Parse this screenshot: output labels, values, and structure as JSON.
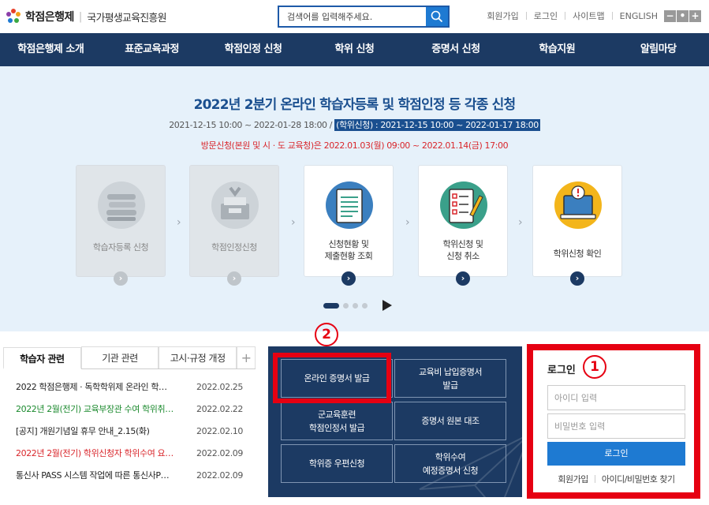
{
  "header": {
    "logo_title": "학점은행제",
    "logo_sub": "국가평생교육진흥원",
    "search_placeholder": "검색어를 입력해주세요.",
    "util_links": [
      "회원가입",
      "로그인",
      "사이트맵",
      "ENGLISH"
    ],
    "font_controls": [
      "−",
      "•",
      "+"
    ]
  },
  "nav": {
    "items": [
      "학점은행제 소개",
      "표준교육과정",
      "학점인정 신청",
      "학위 신청",
      "증명서 신청",
      "학습지원",
      "알림마당"
    ]
  },
  "hero": {
    "title": "2022년 2분기 온라인 학습자등록 및 학점인정 등 각종 신청",
    "date_range": "2021-12-15 10:00 ~ 2022-01-28 18:00 /",
    "date_highlight": "(학위신청) : 2021-12-15 10:00 ~ 2022-01-17 18:00",
    "visit_notice": "방문신청(본원 및 시 · 도 교육청)은 2022.01.03(월) 09:00 ~ 2022.01.14(금) 17:00",
    "cards": [
      {
        "label": "학습자등록 신청",
        "icon": "books-icon",
        "state": "disabled"
      },
      {
        "label": "학점인정신청",
        "icon": "inbox-tray-icon",
        "state": "disabled"
      },
      {
        "label": "신청현황 및\n제출현황 조회",
        "icon": "document-list-icon",
        "state": "active"
      },
      {
        "label": "학위신청 및\n신청 취소",
        "icon": "checklist-pencil-icon",
        "state": "active"
      },
      {
        "label": "학위신청 확인",
        "icon": "laptop-alert-icon",
        "state": "active"
      }
    ],
    "slider_total": 4,
    "slider_current": 1
  },
  "news": {
    "tabs": [
      "학습자 관련",
      "기관 관련",
      "고시·규정 개정"
    ],
    "plus": "+",
    "items": [
      {
        "title": "2022 학점은행제 · 독학학위제 온라인 학…",
        "date": "2022.02.25",
        "color": "dark"
      },
      {
        "title": "2022년 2월(전기) 교육부장관 수여 학위취…",
        "date": "2022.02.22",
        "color": "green"
      },
      {
        "title": "[공지] 개원기념일 휴무 안내_2.15(화)",
        "date": "2022.02.10",
        "color": "dark"
      },
      {
        "title": "2022년 2월(전기) 학위신청자 학위수여 요…",
        "date": "2022.02.09",
        "color": "red"
      },
      {
        "title": "통신사 PASS 시스템 작업에 따른 통신사P…",
        "date": "2022.02.09",
        "color": "dark"
      }
    ]
  },
  "quick": {
    "buttons": [
      "온라인 증명서 발급",
      "교육비 납입증명서\n발급",
      "군교육훈련\n학점인정서 발급",
      "증명서 원본 대조",
      "학위증 우편신청",
      "학위수여\n예정증명서 신청"
    ]
  },
  "login": {
    "title": "로그인",
    "id_placeholder": "아이디 입력",
    "pw_placeholder": "비밀번호 입력",
    "button": "로그인",
    "links": [
      "회원가입",
      "아이디/비밀번호 찾기"
    ]
  },
  "annotations": {
    "badge_1": "1",
    "badge_2": "2",
    "color": "#e60012"
  },
  "colors": {
    "nav": "#1c3a63",
    "accent": "#1e7ad2",
    "hero_bg": "#e6f1fa",
    "alert_red": "#d9262b"
  }
}
